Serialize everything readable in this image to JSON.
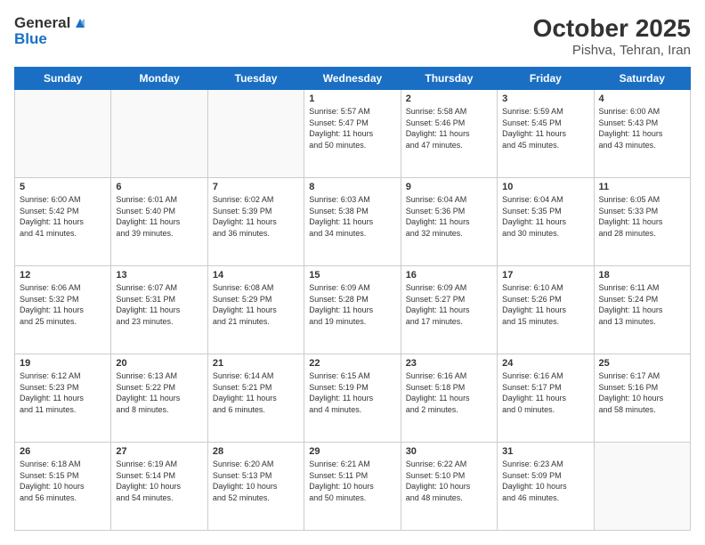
{
  "header": {
    "logo_line1": "General",
    "logo_line2": "Blue",
    "month": "October 2025",
    "location": "Pishva, Tehran, Iran"
  },
  "weekdays": [
    "Sunday",
    "Monday",
    "Tuesday",
    "Wednesday",
    "Thursday",
    "Friday",
    "Saturday"
  ],
  "weeks": [
    [
      {
        "day": "",
        "info": ""
      },
      {
        "day": "",
        "info": ""
      },
      {
        "day": "",
        "info": ""
      },
      {
        "day": "1",
        "info": "Sunrise: 5:57 AM\nSunset: 5:47 PM\nDaylight: 11 hours\nand 50 minutes."
      },
      {
        "day": "2",
        "info": "Sunrise: 5:58 AM\nSunset: 5:46 PM\nDaylight: 11 hours\nand 47 minutes."
      },
      {
        "day": "3",
        "info": "Sunrise: 5:59 AM\nSunset: 5:45 PM\nDaylight: 11 hours\nand 45 minutes."
      },
      {
        "day": "4",
        "info": "Sunrise: 6:00 AM\nSunset: 5:43 PM\nDaylight: 11 hours\nand 43 minutes."
      }
    ],
    [
      {
        "day": "5",
        "info": "Sunrise: 6:00 AM\nSunset: 5:42 PM\nDaylight: 11 hours\nand 41 minutes."
      },
      {
        "day": "6",
        "info": "Sunrise: 6:01 AM\nSunset: 5:40 PM\nDaylight: 11 hours\nand 39 minutes."
      },
      {
        "day": "7",
        "info": "Sunrise: 6:02 AM\nSunset: 5:39 PM\nDaylight: 11 hours\nand 36 minutes."
      },
      {
        "day": "8",
        "info": "Sunrise: 6:03 AM\nSunset: 5:38 PM\nDaylight: 11 hours\nand 34 minutes."
      },
      {
        "day": "9",
        "info": "Sunrise: 6:04 AM\nSunset: 5:36 PM\nDaylight: 11 hours\nand 32 minutes."
      },
      {
        "day": "10",
        "info": "Sunrise: 6:04 AM\nSunset: 5:35 PM\nDaylight: 11 hours\nand 30 minutes."
      },
      {
        "day": "11",
        "info": "Sunrise: 6:05 AM\nSunset: 5:33 PM\nDaylight: 11 hours\nand 28 minutes."
      }
    ],
    [
      {
        "day": "12",
        "info": "Sunrise: 6:06 AM\nSunset: 5:32 PM\nDaylight: 11 hours\nand 25 minutes."
      },
      {
        "day": "13",
        "info": "Sunrise: 6:07 AM\nSunset: 5:31 PM\nDaylight: 11 hours\nand 23 minutes."
      },
      {
        "day": "14",
        "info": "Sunrise: 6:08 AM\nSunset: 5:29 PM\nDaylight: 11 hours\nand 21 minutes."
      },
      {
        "day": "15",
        "info": "Sunrise: 6:09 AM\nSunset: 5:28 PM\nDaylight: 11 hours\nand 19 minutes."
      },
      {
        "day": "16",
        "info": "Sunrise: 6:09 AM\nSunset: 5:27 PM\nDaylight: 11 hours\nand 17 minutes."
      },
      {
        "day": "17",
        "info": "Sunrise: 6:10 AM\nSunset: 5:26 PM\nDaylight: 11 hours\nand 15 minutes."
      },
      {
        "day": "18",
        "info": "Sunrise: 6:11 AM\nSunset: 5:24 PM\nDaylight: 11 hours\nand 13 minutes."
      }
    ],
    [
      {
        "day": "19",
        "info": "Sunrise: 6:12 AM\nSunset: 5:23 PM\nDaylight: 11 hours\nand 11 minutes."
      },
      {
        "day": "20",
        "info": "Sunrise: 6:13 AM\nSunset: 5:22 PM\nDaylight: 11 hours\nand 8 minutes."
      },
      {
        "day": "21",
        "info": "Sunrise: 6:14 AM\nSunset: 5:21 PM\nDaylight: 11 hours\nand 6 minutes."
      },
      {
        "day": "22",
        "info": "Sunrise: 6:15 AM\nSunset: 5:19 PM\nDaylight: 11 hours\nand 4 minutes."
      },
      {
        "day": "23",
        "info": "Sunrise: 6:16 AM\nSunset: 5:18 PM\nDaylight: 11 hours\nand 2 minutes."
      },
      {
        "day": "24",
        "info": "Sunrise: 6:16 AM\nSunset: 5:17 PM\nDaylight: 11 hours\nand 0 minutes."
      },
      {
        "day": "25",
        "info": "Sunrise: 6:17 AM\nSunset: 5:16 PM\nDaylight: 10 hours\nand 58 minutes."
      }
    ],
    [
      {
        "day": "26",
        "info": "Sunrise: 6:18 AM\nSunset: 5:15 PM\nDaylight: 10 hours\nand 56 minutes."
      },
      {
        "day": "27",
        "info": "Sunrise: 6:19 AM\nSunset: 5:14 PM\nDaylight: 10 hours\nand 54 minutes."
      },
      {
        "day": "28",
        "info": "Sunrise: 6:20 AM\nSunset: 5:13 PM\nDaylight: 10 hours\nand 52 minutes."
      },
      {
        "day": "29",
        "info": "Sunrise: 6:21 AM\nSunset: 5:11 PM\nDaylight: 10 hours\nand 50 minutes."
      },
      {
        "day": "30",
        "info": "Sunrise: 6:22 AM\nSunset: 5:10 PM\nDaylight: 10 hours\nand 48 minutes."
      },
      {
        "day": "31",
        "info": "Sunrise: 6:23 AM\nSunset: 5:09 PM\nDaylight: 10 hours\nand 46 minutes."
      },
      {
        "day": "",
        "info": ""
      }
    ]
  ]
}
